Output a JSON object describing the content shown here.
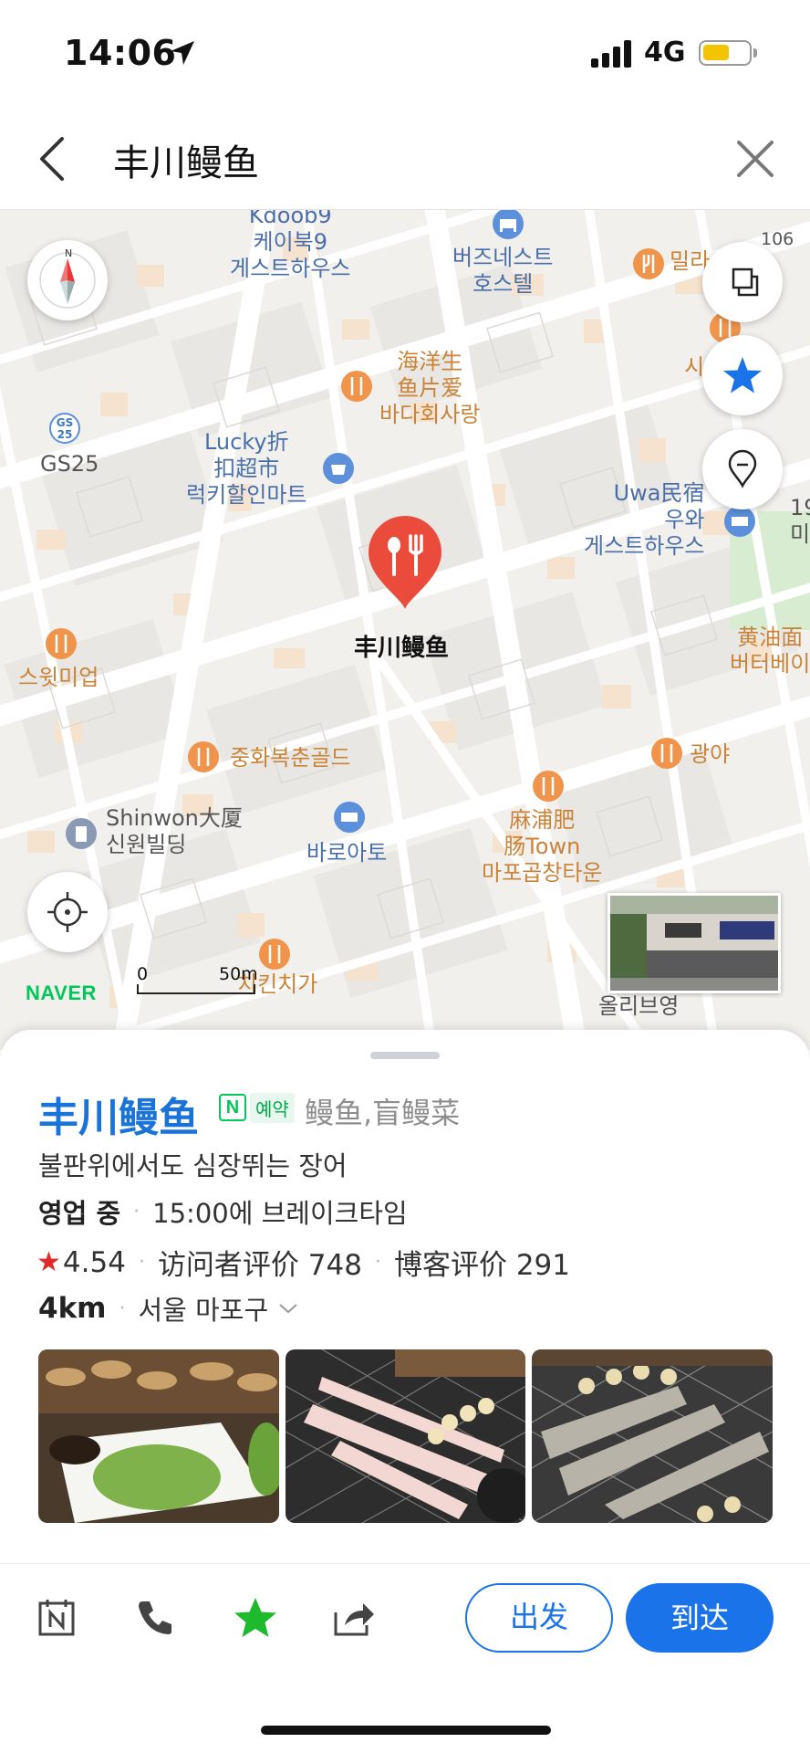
{
  "status_bar": {
    "time": "14:06",
    "network": "4G"
  },
  "search": {
    "query": "丰川鳗鱼"
  },
  "map": {
    "labels": {
      "kdoob": "Kdoob9\n케이북9\n게스트하우스",
      "buzz": "버즈네스트\n호스텔",
      "millar": "밀라",
      "si": "시",
      "haiyang": "海洋生\n鱼片爱\n바다회사랑",
      "gs25": "GS25",
      "lucky": "Lucky折\n扣超市\n럭키할인마트",
      "uwa": "Uwa民宿\n우와\n게스트하우스",
      "n19": "19\n미",
      "marker": "丰川鳗鱼",
      "sweet": "스윗미업",
      "huangyou": "黄油面\n버터베이",
      "jonghwa": "중화복춘골드",
      "gwangya": "광야",
      "shinwon": "Shinwon大厦\n신원빌딩",
      "baroa": "바로아토",
      "mapo": "麻浦肥\n肠Town\n마포곱창타운",
      "chicken": "치킨치가",
      "olive": "올리브영",
      "road106": "106"
    },
    "gs_badge": "GS\n25",
    "brand": "NAVER",
    "scale_start": "0",
    "scale_end": "50m"
  },
  "place": {
    "name": "丰川鳗鱼",
    "booking_letter": "N",
    "booking_label": "예약",
    "category": "鳗鱼,盲鳗菜",
    "description": "불판위에서도 심장뛰는 장어",
    "hours_status": "영업 중",
    "hours_detail": "15:00에 브레이크타임",
    "rating": "4.54",
    "visitor_reviews": "访问者评价 748",
    "blog_reviews": "博客评价 291",
    "distance": "4km",
    "address": "서울 마포구"
  },
  "actions": {
    "depart": "出发",
    "arrive": "到达"
  },
  "colors": {
    "brand_blue": "#1a73e8",
    "naver_green": "#03c75a",
    "marker_red": "#ea4b3a",
    "food_orange": "#f0944b"
  },
  "icons": [
    "location-arrow-icon",
    "signal-icon",
    "battery-icon",
    "back-icon",
    "close-icon",
    "compass-icon",
    "layers-icon",
    "favorite-star-icon",
    "place-pin-icon",
    "gps-target-icon",
    "booking-calendar-icon",
    "phone-icon",
    "star-icon",
    "share-icon"
  ]
}
